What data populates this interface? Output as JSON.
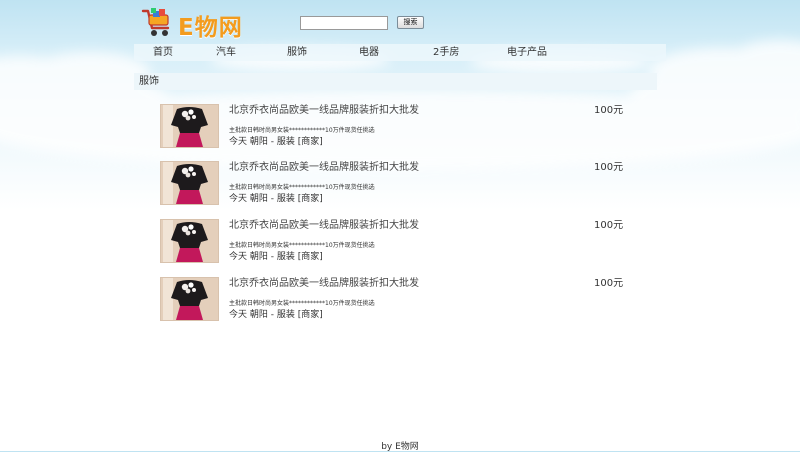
{
  "header": {
    "logo_text": "E物网",
    "search": {
      "value": "",
      "placeholder": ""
    },
    "search_button_label": "搜索"
  },
  "nav": {
    "items": [
      {
        "label": "首页"
      },
      {
        "label": "汽车"
      },
      {
        "label": "服饰"
      },
      {
        "label": "电器"
      },
      {
        "label": "2手房"
      },
      {
        "label": "电子产品"
      }
    ]
  },
  "section": {
    "title": "服饰"
  },
  "listings": [
    {
      "title": "北京乔衣尚品欧美一线品牌服装折扣大批发",
      "price": "100元",
      "description": "主批款日韩时尚男女装************10万件现货任挑选",
      "meta": "今天 朝阳 - 服装 [商家]"
    },
    {
      "title": "北京乔衣尚品欧美一线品牌服装折扣大批发",
      "price": "100元",
      "description": "主批款日韩时尚男女装************10万件现货任挑选",
      "meta": "今天 朝阳 - 服装 [商家]"
    },
    {
      "title": "北京乔衣尚品欧美一线品牌服装折扣大批发",
      "price": "100元",
      "description": "主批款日韩时尚男女装************10万件现货任挑选",
      "meta": "今天 朝阳 - 服装 [商家]"
    },
    {
      "title": "北京乔衣尚品欧美一线品牌服装折扣大批发",
      "price": "100元",
      "description": "主批款日韩时尚男女装************10万件现货任挑选",
      "meta": "今天 朝阳 - 服装 [商家]"
    }
  ],
  "footer": {
    "text": "by E物网"
  },
  "colors": {
    "logo": "#f39c1e",
    "sky_top": "#bfe3f2",
    "section_bar": "#edf6fa"
  }
}
